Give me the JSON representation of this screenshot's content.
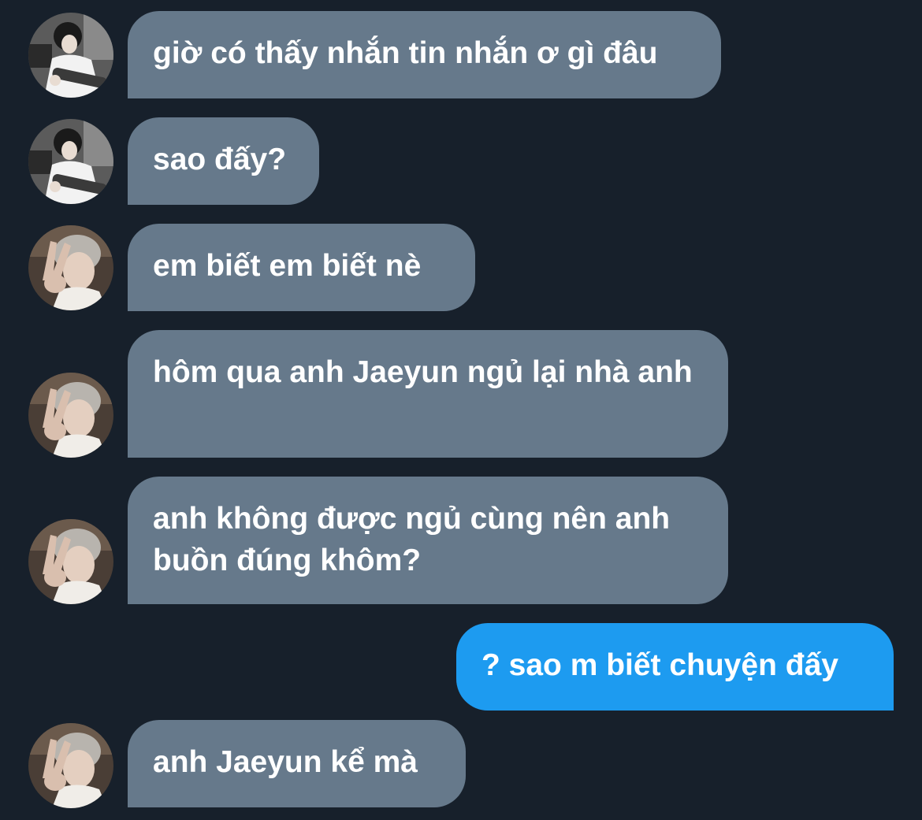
{
  "conversation": {
    "messages": [
      {
        "sender": "other",
        "avatar": "guitar-boy-avatar",
        "text": "giờ có thấy nhắn tin nhắn ơ gì đâu"
      },
      {
        "sender": "other",
        "avatar": "guitar-boy-avatar",
        "text": "sao đấy?"
      },
      {
        "sender": "other",
        "avatar": "peace-sign-avatar",
        "text": "em biết em biết nè"
      },
      {
        "sender": "other",
        "avatar": "peace-sign-avatar",
        "text": "hôm qua anh Jaeyun ngủ lại nhà anh"
      },
      {
        "sender": "other",
        "avatar": "peace-sign-avatar",
        "text": "anh không được ngủ cùng nên anh buồn đúng khôm?"
      },
      {
        "sender": "self",
        "text": "? sao m biết chuyện đấy"
      },
      {
        "sender": "other",
        "avatar": "peace-sign-avatar",
        "text": "anh Jaeyun kể mà"
      }
    ]
  },
  "colors": {
    "background": "#17202b",
    "incoming_bubble": "#66798b",
    "outgoing_bubble": "#1d9bf0",
    "text": "#ffffff"
  }
}
